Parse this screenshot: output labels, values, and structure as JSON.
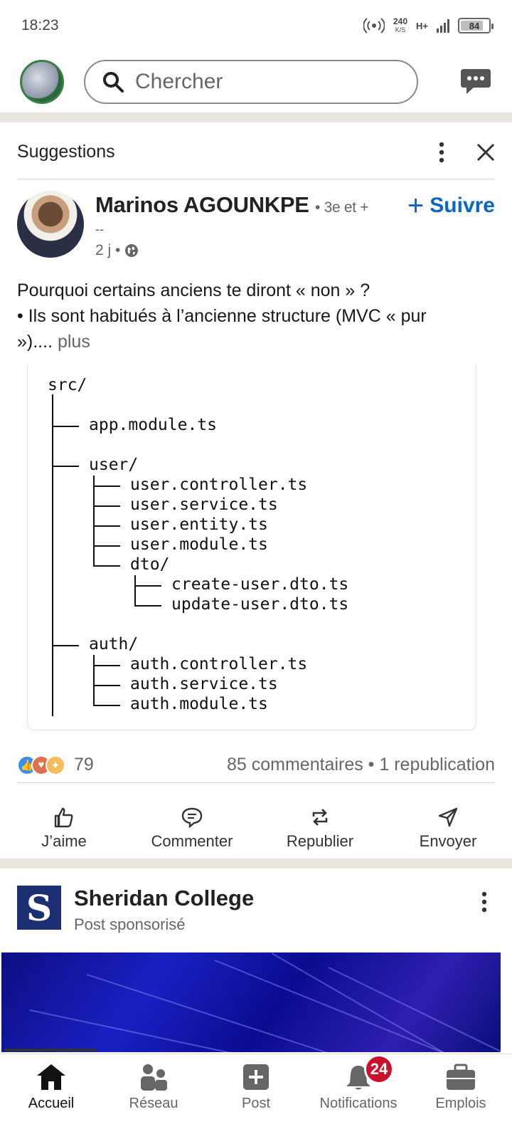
{
  "status_bar": {
    "time": "18:23",
    "net_speed_value": "240",
    "net_speed_unit": "K/S",
    "network_type": "H+",
    "battery": "84",
    "battery_level": 0.84
  },
  "header": {
    "search_placeholder": "Chercher"
  },
  "suggestions": {
    "title": "Suggestions"
  },
  "post": {
    "author_name": "Marinos AGOUNKPE",
    "author_degree": "• 3e et +",
    "author_headline": "--",
    "time_ago": "2 j •",
    "follow_label": "Suivre",
    "text_line1": "Pourquoi certains anciens te diront « non » ?",
    "text_line2": " • Ils sont habitués à l’ancienne structure (MVC « pur",
    "text_line3": "»)....",
    "more_label": " plus",
    "code_tree": {
      "root": "src/",
      "app_module": "app.module.ts",
      "user_dir": "user/",
      "user_controller": "user.controller.ts",
      "user_service": "user.service.ts",
      "user_entity": "user.entity.ts",
      "user_module": "user.module.ts",
      "dto_dir": "dto/",
      "create_dto": "create-user.dto.ts",
      "update_dto": "update-user.dto.ts",
      "auth_dir": "auth/",
      "auth_controller": "auth.controller.ts",
      "auth_service": "auth.service.ts",
      "auth_module": "auth.module.ts"
    },
    "reaction_count": "79",
    "engagement": "85 commentaires • 1 republication",
    "actions": {
      "like": "J’aime",
      "comment": "Commenter",
      "repost": "Republier",
      "send": "Envoyer"
    }
  },
  "sponsored": {
    "logo_letter": "S",
    "name": "Sheridan College",
    "subtitle": "Post sponsorisé"
  },
  "bottom_nav": {
    "home": "Accueil",
    "network": "Réseau",
    "post": "Post",
    "notifications": "Notifications",
    "notifications_badge": "24",
    "jobs": "Emplois"
  },
  "colors": {
    "accent": "#0a66c2",
    "badge": "#cb112d",
    "band": "#e9e5df"
  }
}
